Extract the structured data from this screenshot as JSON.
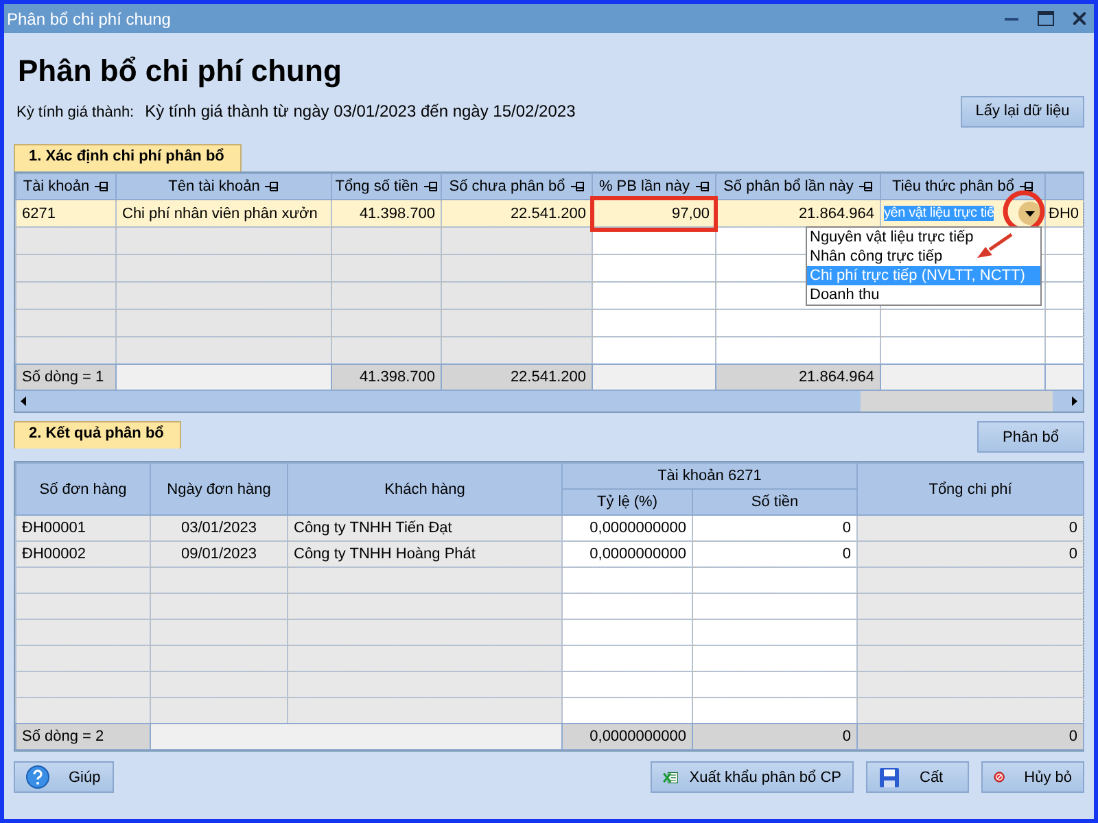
{
  "window": {
    "title": "Phân bổ chi phí chung"
  },
  "heading": "Phân bổ chi phí chung",
  "period": {
    "label": "Kỳ tính giá thành:",
    "value": "Kỳ tính giá thành từ ngày 03/01/2023 đến ngày 15/02/2023"
  },
  "reload_button": "Lấy lại dữ liệu",
  "section_1": {
    "tab": "1. Xác định chi phí phân bổ",
    "columns": [
      "Tài khoản",
      "Tên tài khoản",
      "Tổng số tiền",
      "Số chưa phân bổ",
      "% PB lần này",
      "Số phân bổ lần này",
      "Tiêu thức phân bổ"
    ],
    "rows": [
      {
        "cells": [
          "6271",
          "Chi phí nhân viên phân xưởn",
          "41.398.700",
          "22.541.200",
          "97,00",
          "21.864.964"
        ],
        "allocation_basis": {
          "value": "yên vật liệu trực tiế",
          "expanded": true
        },
        "column_8": "ĐH0"
      }
    ],
    "footer": {
      "row_count": "Số dòng = 1",
      "column_3": "41.398.700",
      "column_4": "22.541.200",
      "column_6": "21.864.964"
    },
    "dropdown_options": [
      {
        "label": "Nguyên vật liệu trực tiếp",
        "selected": false
      },
      {
        "label": "Nhân công trực tiếp",
        "selected": false
      },
      {
        "label": "Chi phí trực tiếp (NVLTT, NCTT)",
        "selected": true
      },
      {
        "label": "Doanh thu",
        "selected": false
      }
    ]
  },
  "section_2": {
    "tab": "2. Kết quả phân bổ",
    "allocate_button": "Phân bổ",
    "group_header": "Tài khoản 6271",
    "columns": [
      "Số đơn hàng",
      "Ngày đơn hàng",
      "Khách hàng",
      "Tỷ lệ (%)",
      "Số tiền",
      "Tổng chi phí"
    ],
    "rows": [
      {
        "cells": [
          "ĐH00001",
          "03/01/2023",
          "Công ty TNHH Tiến Đạt",
          "0,0000000000",
          "0",
          "0"
        ]
      },
      {
        "cells": [
          "ĐH00002",
          "09/01/2023",
          "Công ty TNHH Hoàng Phát",
          "0,0000000000",
          "0",
          "0"
        ]
      }
    ],
    "footer": {
      "row_count": "Số dòng = 2",
      "column_4": "0,0000000000",
      "column_5": "0",
      "column_6": "0"
    }
  },
  "buttons": [
    {
      "kind": "help",
      "label": "Giúp"
    },
    {
      "kind": "export",
      "label": "Xuất khẩu phân bổ CP"
    },
    {
      "kind": "save",
      "label": "Cất"
    },
    {
      "kind": "cancel",
      "label": "Hủy bỏ"
    }
  ]
}
